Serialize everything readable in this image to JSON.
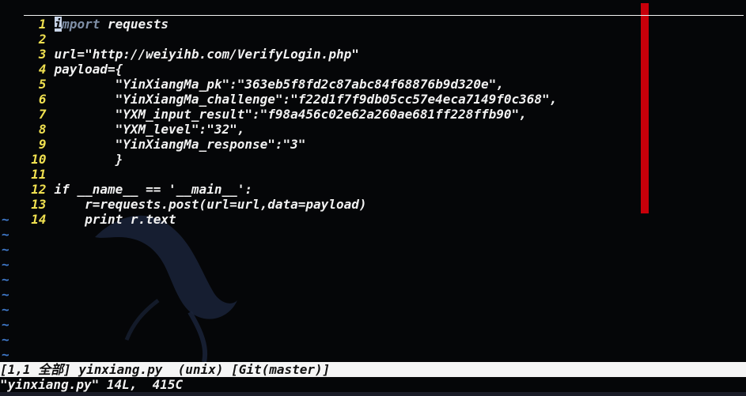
{
  "lines": [
    {
      "num": "1",
      "text": "import requests"
    },
    {
      "num": "2",
      "text": ""
    },
    {
      "num": "3",
      "text": "url=\"http://weiyihb.com/VerifyLogin.php\""
    },
    {
      "num": "4",
      "text": "payload={"
    },
    {
      "num": "5",
      "text": "        \"YinXiangMa_pk\":\"363eb5f8fd2c87abc84f68876b9d320e\","
    },
    {
      "num": "6",
      "text": "        \"YinXiangMa_challenge\":\"f22d1f7f9db05cc57e4eca7149f0c368\","
    },
    {
      "num": "7",
      "text": "        \"YXM_input_result\":\"f98a456c02e62a260ae681ff228ffb90\","
    },
    {
      "num": "8",
      "text": "        \"YXM_level\":\"32\","
    },
    {
      "num": "9",
      "text": "        \"YinXiangMa_response\":\"3\""
    },
    {
      "num": "10",
      "text": "        }"
    },
    {
      "num": "11",
      "text": ""
    },
    {
      "num": "12",
      "text": "if __name__ == '__main__':"
    },
    {
      "num": "13",
      "text": "    r=requests.post(url=url,data=payload)"
    },
    {
      "num": "14",
      "text": "    print r.text"
    }
  ],
  "first_line": {
    "cursor_char": "i",
    "keyword_rest": "mport",
    "rest": " requests"
  },
  "empty_marker": "~",
  "statusline": "[1,1 全部] yinxiang.py  (unix) [Git(master)]",
  "cmdline": "\"yinxiang.py\" 14L,  415C",
  "colors": {
    "line_number": "#f0e050",
    "color_column": "#c8000a",
    "tilde": "#3f78c8",
    "background": "#050608"
  }
}
